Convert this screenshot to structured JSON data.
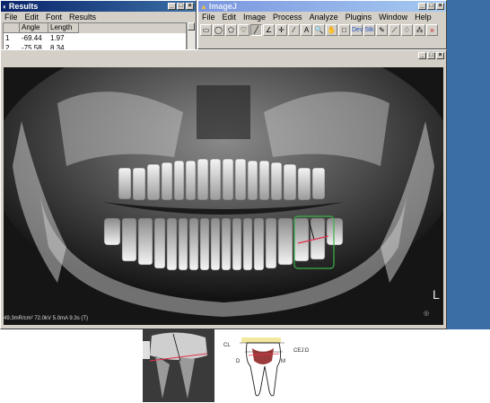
{
  "results_window": {
    "title": "Results",
    "menu": [
      "File",
      "Edit",
      "Font",
      "Results"
    ],
    "columns": [
      "",
      "Angle",
      "Length"
    ],
    "rows": [
      {
        "index": "1",
        "angle": "-69.44",
        "length": "1.97"
      },
      {
        "index": "2",
        "angle": "-75.58",
        "length": "8.34"
      }
    ]
  },
  "imagej_window": {
    "title": "ImageJ",
    "menu": [
      "File",
      "Edit",
      "Image",
      "Process",
      "Analyze",
      "Plugins",
      "Window",
      "Help"
    ],
    "tools": [
      {
        "icon": "rectangle-tool-icon",
        "glyph": "▭"
      },
      {
        "icon": "oval-tool-icon",
        "glyph": "◯"
      },
      {
        "icon": "polygon-tool-icon",
        "glyph": "⬠"
      },
      {
        "icon": "freehand-tool-icon",
        "glyph": "♡"
      },
      {
        "icon": "line-tool-icon",
        "glyph": "╱"
      },
      {
        "icon": "angle-tool-icon",
        "glyph": "∠"
      },
      {
        "icon": "point-tool-icon",
        "glyph": "✛"
      },
      {
        "icon": "wand-tool-icon",
        "glyph": "⁄"
      },
      {
        "icon": "text-tool-icon",
        "glyph": "A"
      },
      {
        "icon": "magnifier-tool-icon",
        "glyph": "🔍"
      },
      {
        "icon": "hand-tool-icon",
        "glyph": "✋"
      },
      {
        "icon": "color-picker-tool-icon",
        "glyph": "□"
      },
      {
        "icon": "dev-tool-icon",
        "glyph": "Dev"
      },
      {
        "icon": "stk-tool-icon",
        "glyph": "Stk"
      },
      {
        "icon": "pencil-tool-icon",
        "glyph": "✎"
      },
      {
        "icon": "brush-tool-icon",
        "glyph": "⟋"
      },
      {
        "icon": "flood-fill-tool-icon",
        "glyph": "♢"
      },
      {
        "icon": "spray-tool-icon",
        "glyph": "⁂"
      },
      {
        "icon": "more-tools-icon",
        "glyph": "»"
      }
    ]
  },
  "image_window": {
    "status": "49.3mR/cm² 72.0kV 5.0mA 9.3s (T)",
    "marker_L": "L"
  },
  "diagram": {
    "labels": {
      "cl": "CL",
      "cejd": "CEJ:D",
      "d": "D",
      "m": "M"
    }
  },
  "colors": {
    "title_active": "#0a246a",
    "title_inactive": "#7a96df",
    "desktop": "#3a6ea5",
    "roi_green": "#3cb24a",
    "measure_red": "#e0304a"
  }
}
